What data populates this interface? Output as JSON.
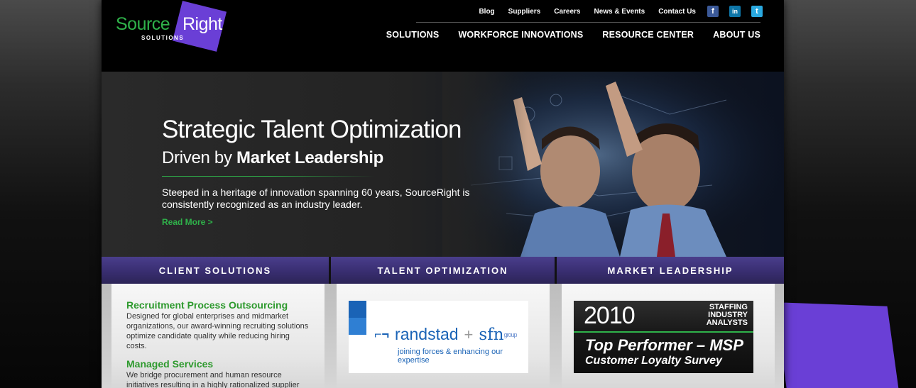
{
  "header": {
    "logo": {
      "word1": "Source",
      "word2": "Right",
      "sub": "SOLUTIONS"
    },
    "utility": [
      "Blog",
      "Suppliers",
      "Careers",
      "News & Events",
      "Contact Us"
    ],
    "social": [
      {
        "name": "facebook",
        "glyph": "f"
      },
      {
        "name": "linkedin",
        "glyph": "in"
      },
      {
        "name": "twitter",
        "glyph": "t"
      }
    ],
    "nav": [
      "SOLUTIONS",
      "WORKFORCE INNOVATIONS",
      "RESOURCE CENTER",
      "ABOUT US"
    ]
  },
  "hero": {
    "title": "Strategic Talent Optimization",
    "subtitle_pre": "Driven by ",
    "subtitle_bold": "Market Leadership",
    "body": "Steeped in a heritage of innovation spanning 60 years, SourceRight is consistently recognized as an industry leader.",
    "read_more": "Read More >"
  },
  "tabs": [
    "CLIENT SOLUTIONS",
    "TALENT OPTIMIZATION",
    "MARKET LEADERSHIP"
  ],
  "client": {
    "items": [
      {
        "title": "Recruitment Process Outsourcing",
        "text": "Designed for global enterprises and midmarket organizations, our award-winning recruiting solutions optimize candidate quality while reducing hiring costs."
      },
      {
        "title": "Managed Services",
        "text": "We bridge procurement and human resource initiatives resulting in a highly rationalized supplier"
      }
    ]
  },
  "talent": {
    "brand1": "randstad",
    "plus": "+",
    "brand2": "sfn",
    "brand2_suffix": "group",
    "tagline": "joining forces & enhancing our expertise"
  },
  "market": {
    "year": "2010",
    "sia": [
      "STAFFING",
      "INDUSTRY",
      "ANALYSTS"
    ],
    "headline": "Top Performer – MSP",
    "subline": "Customer Loyalty Survey"
  },
  "colors": {
    "brand_green": "#2fb24a",
    "brand_purple": "#6a3fd6",
    "tab_purple": "#3a2f73"
  }
}
